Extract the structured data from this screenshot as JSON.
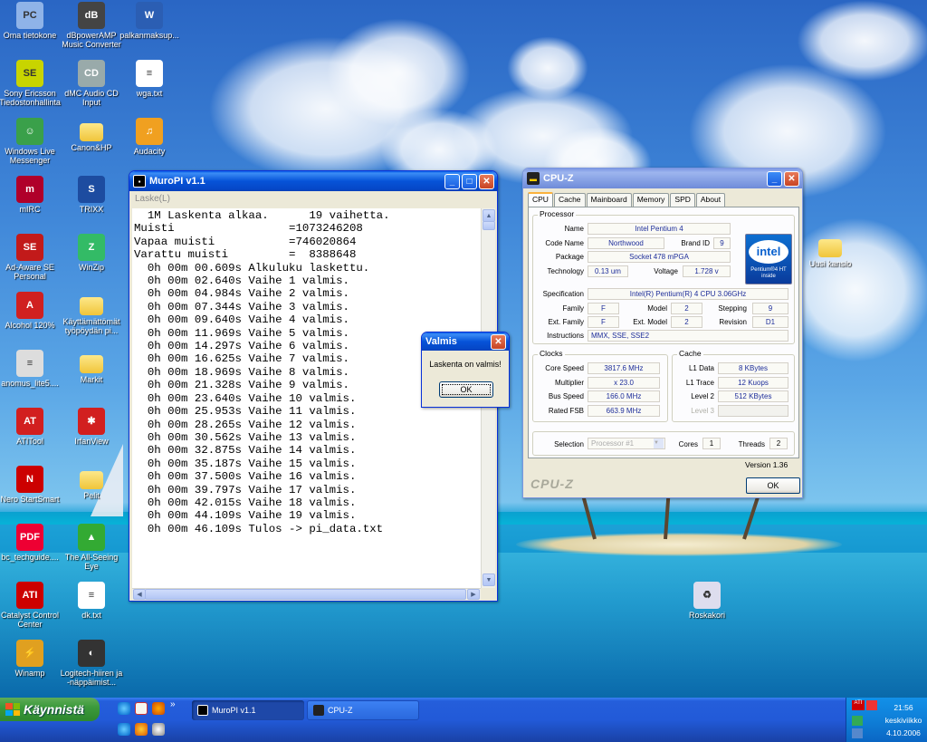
{
  "desktop": {
    "icons": [
      {
        "label": "Oma tietokone",
        "color": "#8fb3e8",
        "glyph": "PC"
      },
      {
        "label": "dBpowerAMP Music Converter",
        "color": "#444",
        "glyph": "dB"
      },
      {
        "label": "palkanmaksup...",
        "color": "#2b5eb3",
        "glyph": "W"
      },
      {
        "label": "Sony Ericsson Tiedostonhallinta",
        "color": "#c8d400",
        "glyph": "SE"
      },
      {
        "label": "dMC Audio CD Input",
        "color": "#9aa",
        "glyph": "CD"
      },
      {
        "label": "wga.txt",
        "color": "#fff",
        "glyph": "≡"
      },
      {
        "label": "Windows Live Messenger",
        "color": "#3aa04a",
        "glyph": "☺"
      },
      {
        "label": "Canon&HP",
        "folder": true
      },
      {
        "label": "Audacity",
        "color": "#f0a020",
        "glyph": "♫"
      },
      {
        "label": "mIRC",
        "color": "#b0002a",
        "glyph": "m"
      },
      {
        "label": "TRIXX",
        "color": "#1d4ca0",
        "glyph": "S"
      },
      {
        "label": "Ad-Aware SE Personal",
        "color": "#c21a1a",
        "glyph": "SE"
      },
      {
        "label": "WinZip",
        "color": "#3b6",
        "glyph": "Z"
      },
      {
        "label": "Alcohol 120%",
        "color": "#d02020",
        "glyph": "A"
      },
      {
        "label": "Käyttämättömät työpöydän pi...",
        "folder": true
      },
      {
        "label": "anomus_lite5....",
        "color": "#ddd",
        "glyph": "≡"
      },
      {
        "label": "Markit",
        "folder": true
      },
      {
        "label": "ATITool",
        "color": "#d21f1f",
        "glyph": "AT"
      },
      {
        "label": "IrfanView",
        "color": "#d21f1f",
        "glyph": "✱"
      },
      {
        "label": "Nero StartSmart",
        "color": "#c00",
        "glyph": "N"
      },
      {
        "label": "Pelit",
        "folder": true
      },
      {
        "label": "bc_techguide....",
        "color": "#e03",
        "glyph": "PDF"
      },
      {
        "label": "The All-Seeing Eye",
        "color": "#3a3",
        "glyph": "▲"
      },
      {
        "label": "Catalyst Control Center",
        "color": "#c00",
        "glyph": "ATI"
      },
      {
        "label": "dk.txt",
        "color": "#fff",
        "glyph": "≡"
      },
      {
        "label": "Winamp",
        "color": "#e0a020",
        "glyph": "⚡"
      },
      {
        "label": "Logitech-hiiren ja -näppäimist...",
        "color": "#333",
        "glyph": "◐"
      },
      {
        "label": "Uusi kansio",
        "folder": true
      },
      {
        "label": "Roskakori",
        "color": "#dde",
        "glyph": "♻"
      }
    ]
  },
  "muropi": {
    "title": "MuroPI v1.1",
    "menu": "Laske(L)",
    "lines": [
      "  1M Laskenta alkaa.      19 vaihetta.",
      "Muisti                 =1073246208",
      "Vapaa muisti           =746020864",
      "Varattu muisti         =  8388648",
      "  0h 00m 00.609s Alkuluku laskettu.",
      "  0h 00m 02.640s Vaihe 1 valmis.",
      "  0h 00m 04.984s Vaihe 2 valmis.",
      "  0h 00m 07.344s Vaihe 3 valmis.",
      "  0h 00m 09.640s Vaihe 4 valmis.",
      "  0h 00m 11.969s Vaihe 5 valmis.",
      "  0h 00m 14.297s Vaihe 6 valmis.",
      "  0h 00m 16.625s Vaihe 7 valmis.",
      "  0h 00m 18.969s Vaihe 8 valmis.",
      "  0h 00m 21.328s Vaihe 9 valmis.",
      "  0h 00m 23.640s Vaihe 10 valmis.",
      "  0h 00m 25.953s Vaihe 11 valmis.",
      "  0h 00m 28.265s Vaihe 12 valmis.",
      "  0h 00m 30.562s Vaihe 13 valmis.",
      "  0h 00m 32.875s Vaihe 14 valmis.",
      "  0h 00m 35.187s Vaihe 15 valmis.",
      "  0h 00m 37.500s Vaihe 16 valmis.",
      "  0h 00m 39.797s Vaihe 17 valmis.",
      "  0h 00m 42.015s Vaihe 18 valmis.",
      "  0h 00m 44.109s Vaihe 19 valmis.",
      "  0h 00m 46.109s Tulos -> pi_data.txt"
    ]
  },
  "dialog": {
    "title": "Valmis",
    "message": "Laskenta on valmis!",
    "ok": "OK"
  },
  "cpuz": {
    "title": "CPU-Z",
    "tabs": [
      "CPU",
      "Cache",
      "Mainboard",
      "Memory",
      "SPD",
      "About"
    ],
    "active_tab": "CPU",
    "processor_group": "Processor",
    "name_label": "Name",
    "name": "Intel Pentium 4",
    "codename_label": "Code Name",
    "codename": "Northwood",
    "brandid_label": "Brand ID",
    "brandid": "9",
    "package_label": "Package",
    "package": "Socket 478 mPGA",
    "technology_label": "Technology",
    "technology": "0.13 um",
    "voltage_label": "Voltage",
    "voltage": "1.728 v",
    "spec_label": "Specification",
    "spec": "Intel(R) Pentium(R) 4 CPU 3.06GHz",
    "family_label": "Family",
    "family": "F",
    "model_label": "Model",
    "model": "2",
    "stepping_label": "Stepping",
    "stepping": "9",
    "extfamily_label": "Ext. Family",
    "extfamily": "F",
    "extmodel_label": "Ext. Model",
    "extmodel": "2",
    "revision_label": "Revision",
    "revision": "D1",
    "instructions_label": "Instructions",
    "instructions": "MMX, SSE, SSE2",
    "intel_logo": "intel",
    "intel_sub": "Pentium®4 HT inside",
    "clocks_group": "Clocks",
    "corespeed_label": "Core Speed",
    "corespeed": "3817.6 MHz",
    "multiplier_label": "Multiplier",
    "multiplier": "x 23.0",
    "busspeed_label": "Bus Speed",
    "busspeed": "166.0 MHz",
    "ratedfsb_label": "Rated FSB",
    "ratedfsb": "663.9 MHz",
    "cache_group": "Cache",
    "l1data_label": "L1 Data",
    "l1data": "8 KBytes",
    "l1trace_label": "L1 Trace",
    "l1trace": "12 Kuops",
    "level2_label": "Level 2",
    "level2": "512 KBytes",
    "level3_label": "Level 3",
    "selection_label": "Selection",
    "selection": "Processor #1",
    "cores_label": "Cores",
    "cores": "1",
    "threads_label": "Threads",
    "threads": "2",
    "version": "Version 1.36",
    "footer_logo": "CPU-Z",
    "ok": "OK"
  },
  "taskbar": {
    "start": "Käynnistä",
    "tasks": [
      "MuroPI v1.1",
      "CPU-Z"
    ],
    "time": "21:56",
    "day": "keskiviikko",
    "date": "4.10.2006"
  }
}
